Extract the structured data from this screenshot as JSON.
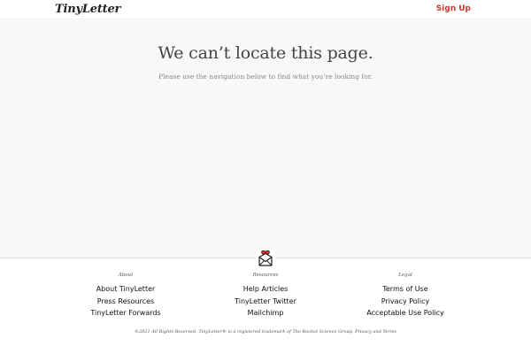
{
  "header": {
    "logo": "TinyLetter",
    "signup_label": "Sign Up"
  },
  "colors": {
    "accent": "#d9332b",
    "heart": "#e0302a",
    "background": "#f8f8f8"
  },
  "main": {
    "headline": "We can’t locate this page.",
    "subtext": "Please use the navigation below to find what you’re looking for."
  },
  "footer": {
    "emblem_icon": "envelope-heart-icon",
    "columns": [
      {
        "heading": "About",
        "links": [
          "About TinyLetter",
          "Press Resources",
          "TinyLetter Forwards"
        ]
      },
      {
        "heading": "Resources",
        "links": [
          "Help Articles",
          "TinyLetter Twitter",
          "Mailchimp"
        ]
      },
      {
        "heading": "Legal",
        "links": [
          "Terms of Use",
          "Privacy Policy",
          "Acceptable Use Policy"
        ]
      }
    ],
    "copyright_text": "©2021 All Rights Reserved. TinyLetter® is a registered trademark of The Rocket Science Group.",
    "privacy_link": "Privacy",
    "and_text": "and",
    "terms_link": "Terms"
  }
}
